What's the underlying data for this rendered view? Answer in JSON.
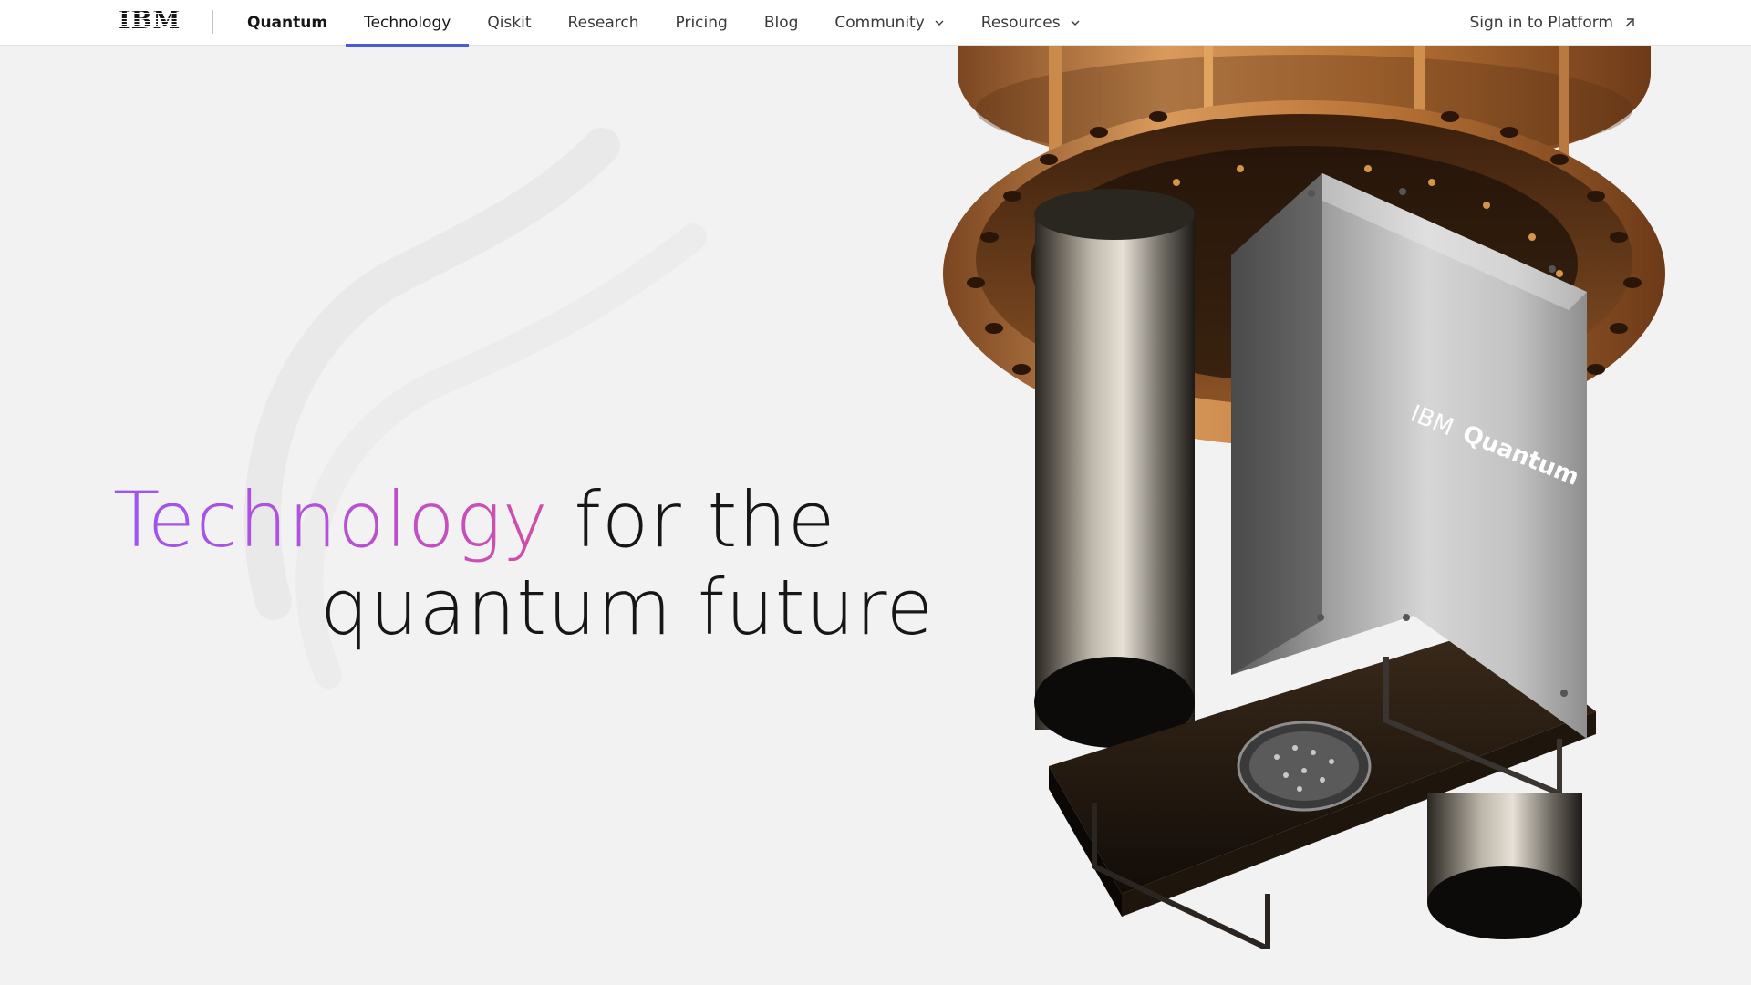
{
  "nav": {
    "logo": "IBM",
    "brand": "Quantum",
    "items": [
      {
        "label": "Technology",
        "active": true
      },
      {
        "label": "Qiskit"
      },
      {
        "label": "Research"
      },
      {
        "label": "Pricing"
      },
      {
        "label": "Blog"
      },
      {
        "label": "Community",
        "dropdown": true
      },
      {
        "label": "Resources",
        "dropdown": true
      }
    ],
    "signin": "Sign in to Platform",
    "active_color": "#4d5ad8"
  },
  "hero": {
    "title_accent": "Technology",
    "title_rest_1": " for the",
    "title_line_2": "quantum future",
    "gradient": [
      "#9c55f0",
      "#d24ea6"
    ]
  },
  "product": {
    "label_light": "IBM",
    "label_bold": "Quantum"
  },
  "colors": {
    "background": "#f2f2f2",
    "copper": "#c8824a",
    "steel": "#b8b8b8"
  }
}
